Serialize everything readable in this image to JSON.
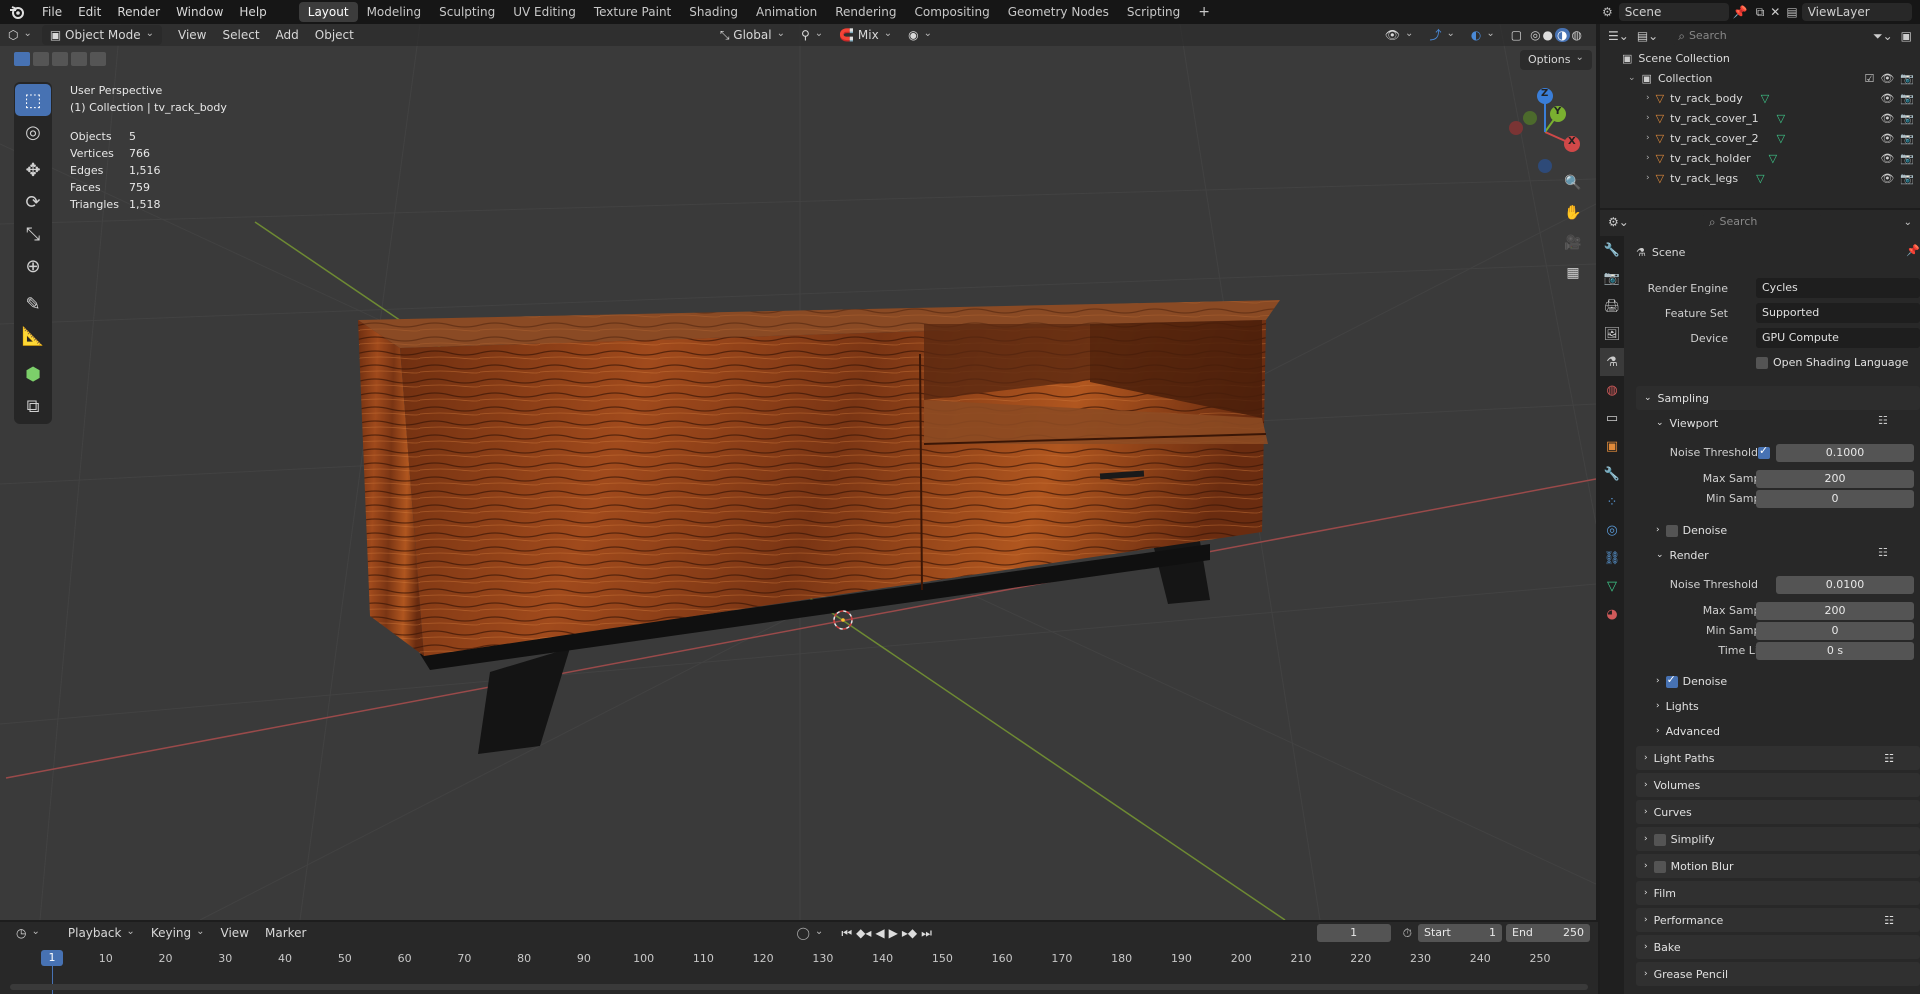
{
  "app": {
    "logo": "blender-logo-icon"
  },
  "menu": [
    "File",
    "Edit",
    "Render",
    "Window",
    "Help"
  ],
  "workspaces": [
    "Layout",
    "Modeling",
    "Sculpting",
    "UV Editing",
    "Texture Paint",
    "Shading",
    "Animation",
    "Rendering",
    "Compositing",
    "Geometry Nodes",
    "Scripting"
  ],
  "active_workspace": "Layout",
  "add_workspace": "+",
  "scene_name": "Scene",
  "view_layer": "ViewLayer",
  "viewport_header": {
    "mode": "Object Mode",
    "items": [
      "View",
      "Select",
      "Add",
      "Object"
    ],
    "transform": "Global",
    "snap": "Mix",
    "options": "Options"
  },
  "overlay_text": {
    "perspective": "User Perspective",
    "collection": "(1) Collection | tv_rack_body",
    "stats": [
      {
        "k": "Objects",
        "v": "5"
      },
      {
        "k": "Vertices",
        "v": "766"
      },
      {
        "k": "Edges",
        "v": "1,516"
      },
      {
        "k": "Faces",
        "v": "759"
      },
      {
        "k": "Triangles",
        "v": "1,518"
      }
    ]
  },
  "gizmo": {
    "x": "X",
    "y": "Y",
    "z": "Z"
  },
  "outliner": {
    "search_placeholder": "Search",
    "scene_collection": "Scene Collection",
    "collection": "Collection",
    "objects": [
      "tv_rack_body",
      "tv_rack_cover_1",
      "tv_rack_cover_2",
      "tv_rack_holder",
      "tv_rack_legs"
    ]
  },
  "properties": {
    "search_placeholder": "Search",
    "context": "Scene",
    "render_engine_label": "Render Engine",
    "render_engine": "Cycles",
    "feature_set_label": "Feature Set",
    "feature_set": "Supported",
    "device_label": "Device",
    "device": "GPU Compute",
    "osl_label": "Open Shading Language",
    "sampling": "Sampling",
    "viewport": "Viewport",
    "noise_threshold_label": "Noise Threshold",
    "vp_noise": "0.1000",
    "max_samples_label": "Max Samples",
    "vp_max": "200",
    "min_samples_label": "Min Samples",
    "vp_min": "0",
    "denoise": "Denoise",
    "render": "Render",
    "r_noise": "0.0100",
    "r_max": "200",
    "r_min": "0",
    "time_limit_label": "Time Limit",
    "r_time": "0 s",
    "lights": "Lights",
    "advanced": "Advanced",
    "panels": [
      "Light Paths",
      "Volumes",
      "Curves",
      "Simplify",
      "Motion Blur",
      "Film",
      "Performance",
      "Bake",
      "Grease Pencil"
    ]
  },
  "timeline": {
    "items": [
      "Playback",
      "Keying",
      "View",
      "Marker"
    ],
    "current_frame": "1",
    "start_label": "Start",
    "start": "1",
    "end_label": "End",
    "end": "250",
    "ruler": [
      "1",
      "10",
      "20",
      "30",
      "40",
      "50",
      "60",
      "70",
      "80",
      "90",
      "100",
      "110",
      "120",
      "130",
      "140",
      "150",
      "160",
      "170",
      "180",
      "190",
      "200",
      "210",
      "220",
      "230",
      "240",
      "250"
    ]
  }
}
